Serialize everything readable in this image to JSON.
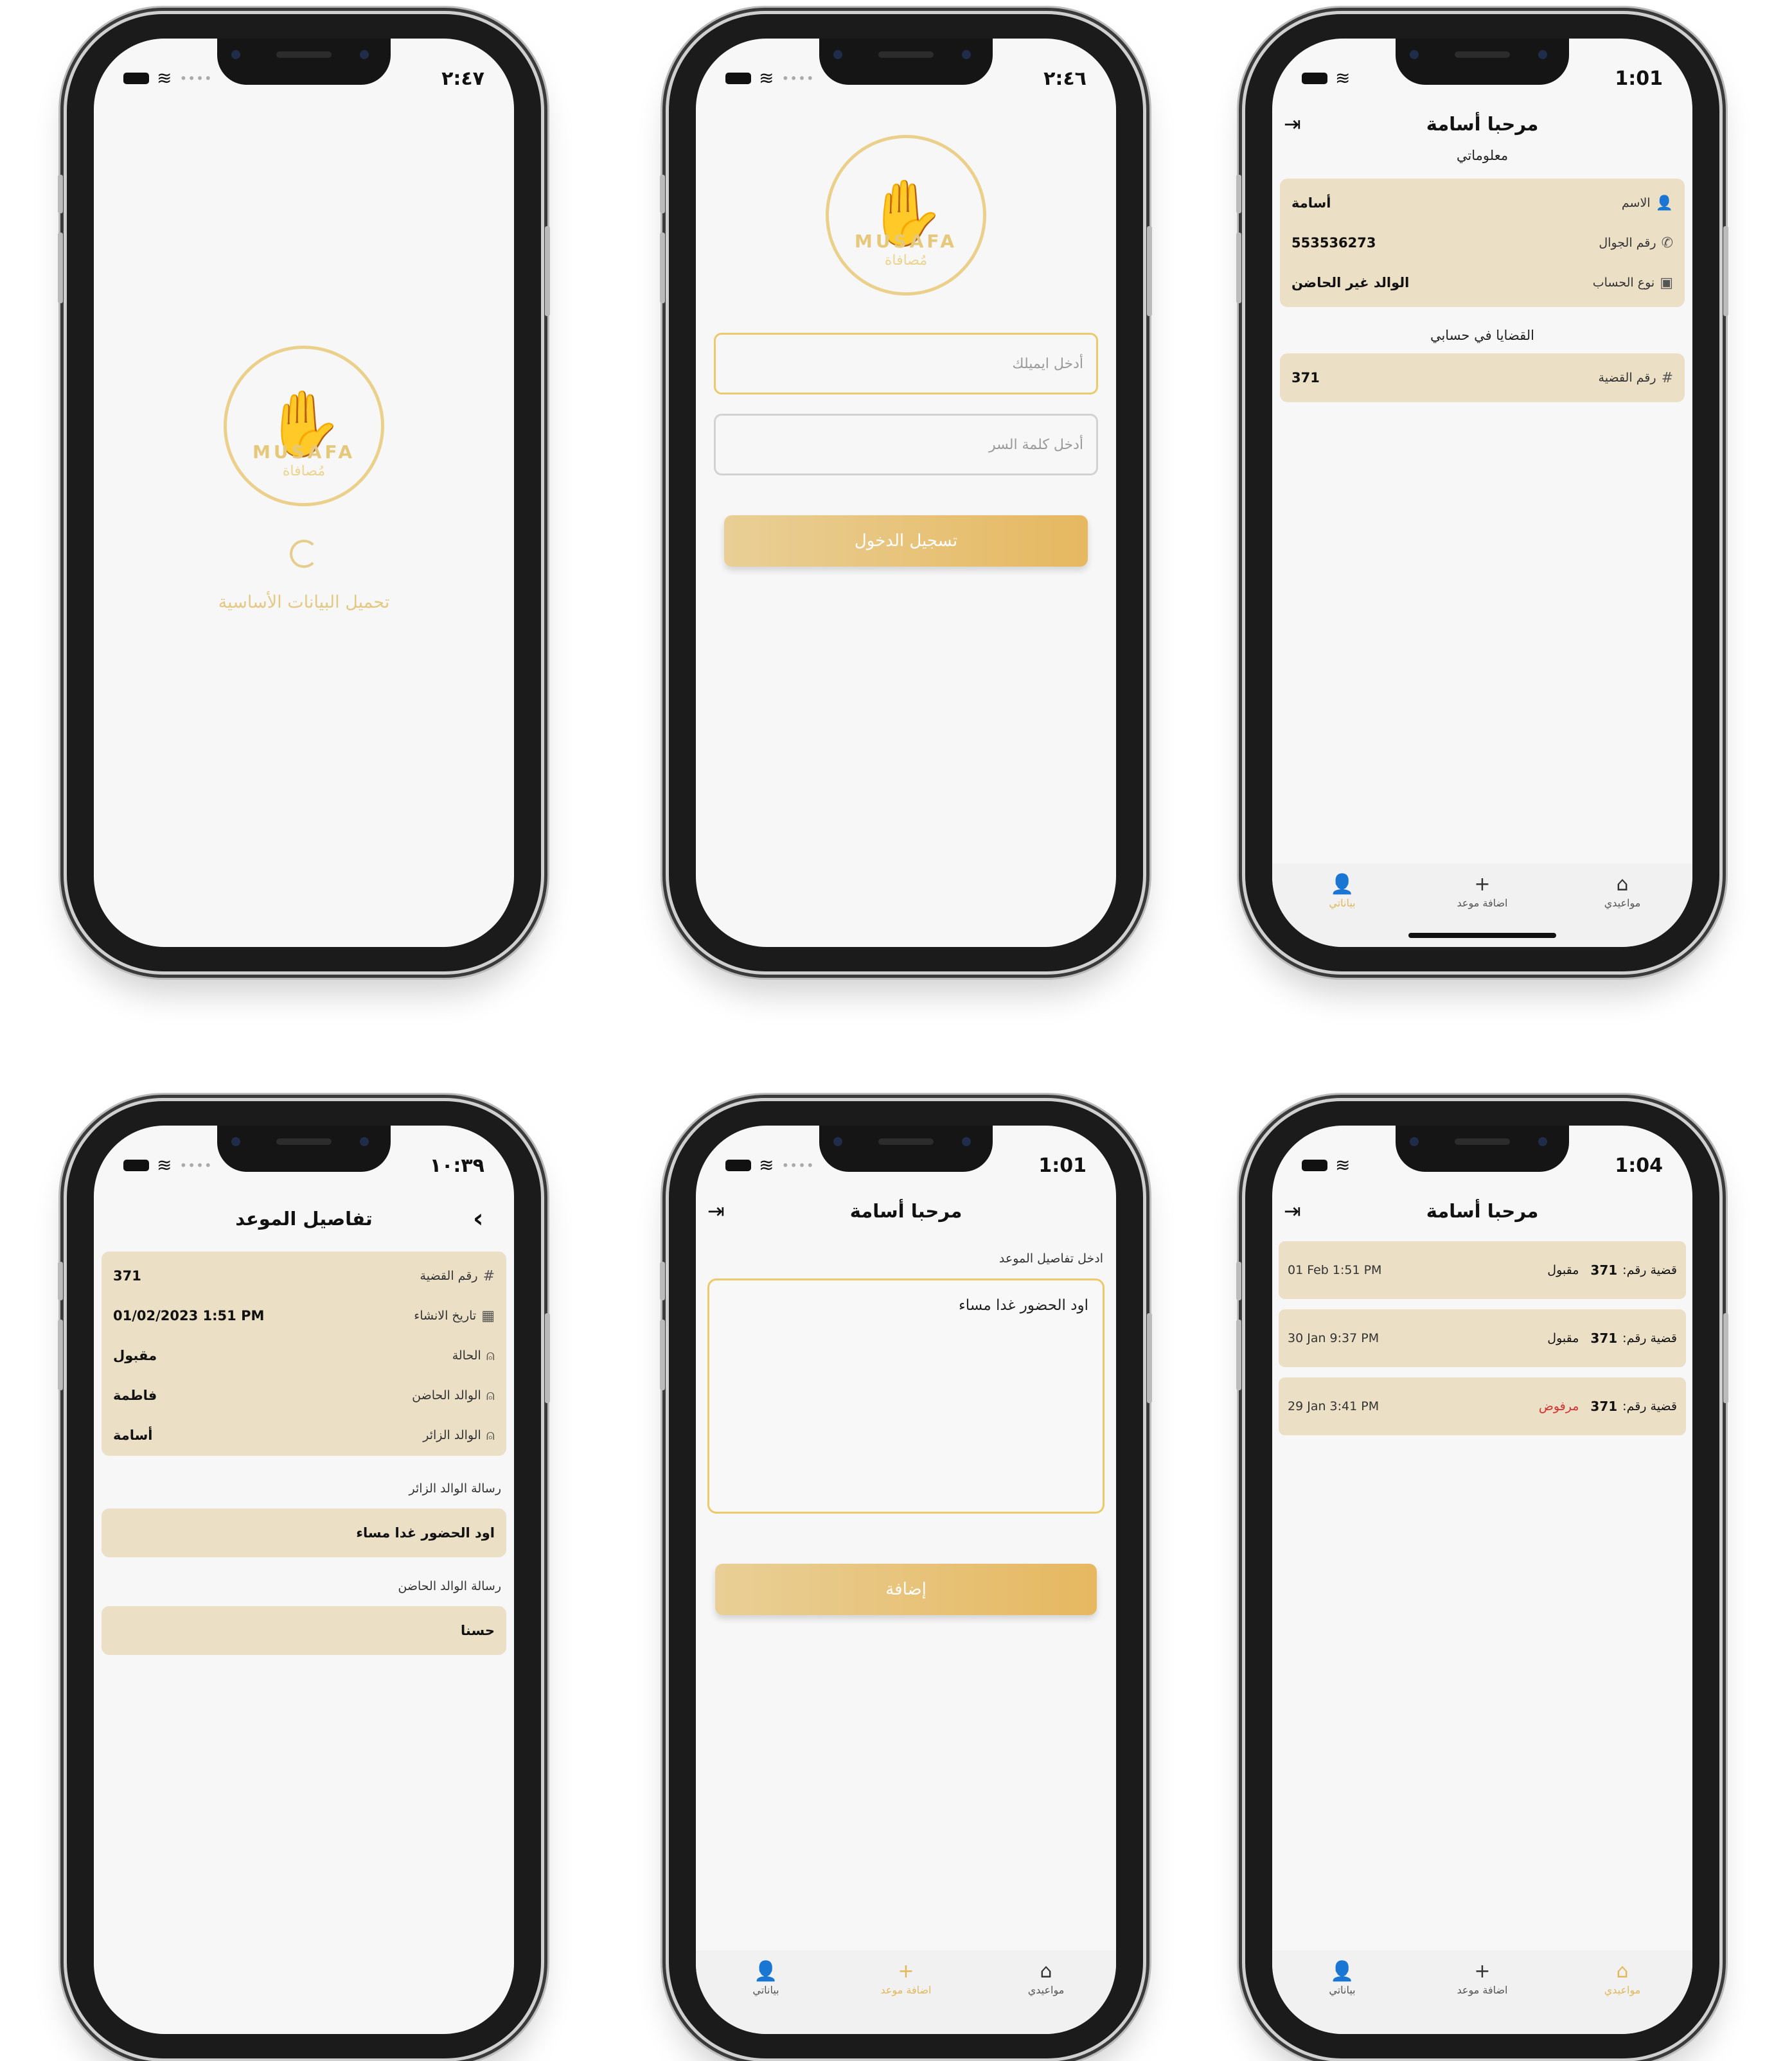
{
  "theme": {
    "accent": "#e6b860",
    "card": "#ebdfc6",
    "danger": "#d62f2f"
  },
  "screens": {
    "splash": {
      "time": "٢:٤٧",
      "logo_en": "MUSAFA",
      "logo_ar": "مُصافاة",
      "loading_text": "تحميل البيانات الأساسية"
    },
    "login": {
      "time": "٢:٤٦",
      "logo_en": "MUSAFA",
      "logo_ar": "مُصافاة",
      "email_placeholder": "أدخل ايميلك",
      "password_placeholder": "أدخل كلمة السر",
      "login_button": "تسجيل الدخول"
    },
    "profile": {
      "time": "1:01",
      "title": "مرحبا أسامة",
      "my_info_label": "معلوماتي",
      "name_label": "الاسم",
      "name_value": "أسامة",
      "phone_label": "رقم الجوال",
      "phone_value": "553536273",
      "account_label": "نوع الحساب",
      "account_value": "الوالد غير الحاضن",
      "cases_label": "القضايا في حسابي",
      "case_no_label": "رقم القضية",
      "case_no_value": "371"
    },
    "details": {
      "time": "١٠:٣٩",
      "title": "تفاصيل الموعد",
      "rows": [
        {
          "label": "رقم القضية",
          "value": "371",
          "icon": "#"
        },
        {
          "label": "تاريخ الانشاء",
          "value": "01/02/2023 1:51 PM",
          "icon": "▦"
        },
        {
          "label": "الحالة",
          "value": "مقبول",
          "icon": "⍝"
        },
        {
          "label": "الوالد الحاضن",
          "value": "فاطمة",
          "icon": "⍝"
        },
        {
          "label": "الوالد الزائر",
          "value": "أسامة",
          "icon": "⍝"
        }
      ],
      "visitor_msg_label": "رسالة الوالد الزائر",
      "visitor_msg": "اود الحضور غدا مساء",
      "custodian_msg_label": "رسالة الوالد الحاضن",
      "custodian_msg": "حسنا"
    },
    "add_appointment": {
      "time": "1:01",
      "title": "مرحبا أسامة",
      "details_label": "ادخل تفاصيل الموعد",
      "details_value": "اود الحضور غدا مساء",
      "add_button": "إضافة"
    },
    "appointments": {
      "time": "1:04",
      "title": "مرحبا أسامة",
      "case_prefix": "قضية رقم:",
      "items": [
        {
          "case": "371",
          "status": "مقبول",
          "date": "01 Feb 1:51 PM",
          "rejected": false
        },
        {
          "case": "371",
          "status": "مقبول",
          "date": "30 Jan 9:37 PM",
          "rejected": false
        },
        {
          "case": "371",
          "status": "مرفوض",
          "date": "29 Jan 3:41 PM",
          "rejected": true
        }
      ]
    }
  },
  "tabs": {
    "profile": "بياناتي",
    "add": "اضافة موعد",
    "appointments": "مواعيدي",
    "profile_icon": "person-icon",
    "add_icon": "plus-icon",
    "home_icon": "home-icon"
  }
}
